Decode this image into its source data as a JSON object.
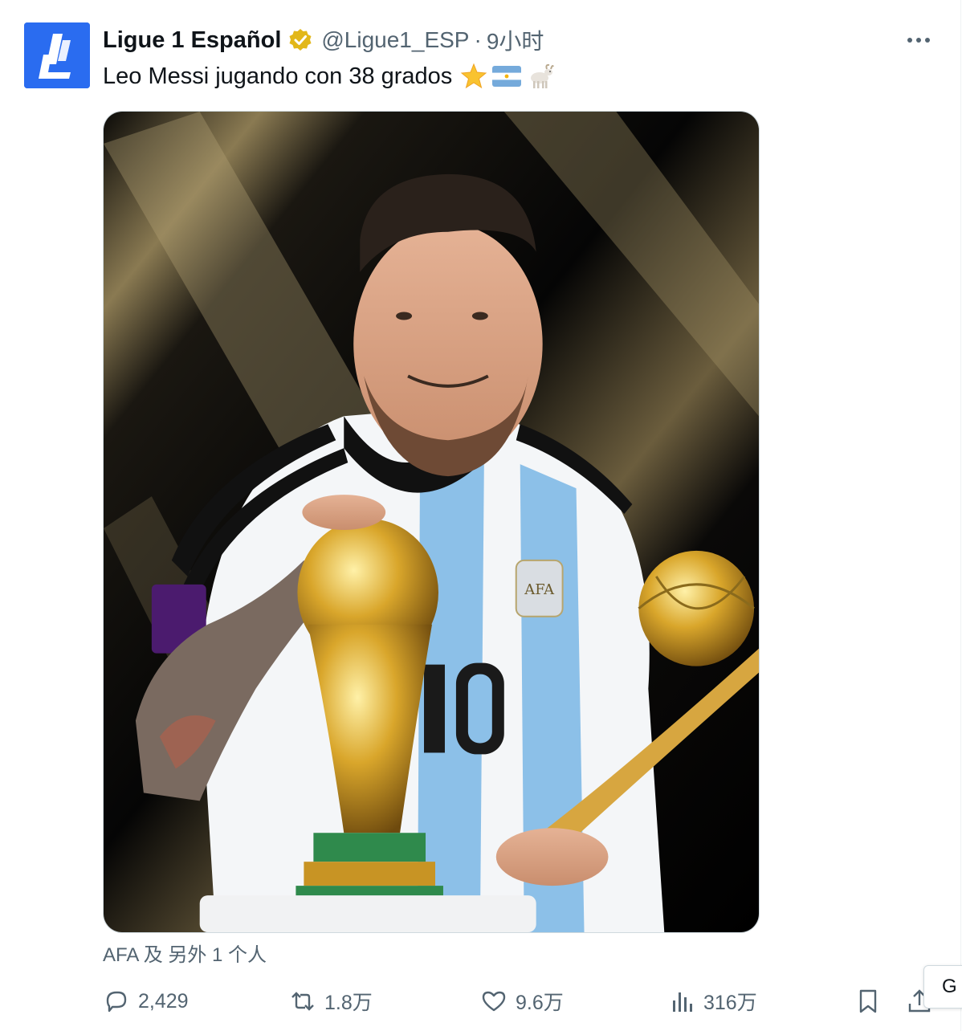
{
  "account": {
    "display_name": "Ligue 1 Español",
    "handle": "@Ligue1_ESP",
    "separator": "·",
    "timestamp": "9小时",
    "verified_icon": "gold-verified-badge"
  },
  "tweet": {
    "text": "Leo Messi jugando con 38 grados",
    "emojis": [
      "star-emoji",
      "argentina-flag-emoji",
      "goat-emoji"
    ]
  },
  "media": {
    "subject": "photo",
    "jersey_number": "10",
    "crest_text": "AFA"
  },
  "tagged": {
    "text": "AFA 及 另外 1 个人"
  },
  "actions": {
    "reply_count": "2,429",
    "retweet_count": "1.8万",
    "like_count": "9.6万",
    "view_count": "316万"
  },
  "overlay": {
    "translate_label": "G"
  },
  "colors": {
    "brand_avatar": "#2a6cf0",
    "text_primary": "#0f1419",
    "text_secondary": "#536471",
    "verified_gold": "#e2b719"
  }
}
